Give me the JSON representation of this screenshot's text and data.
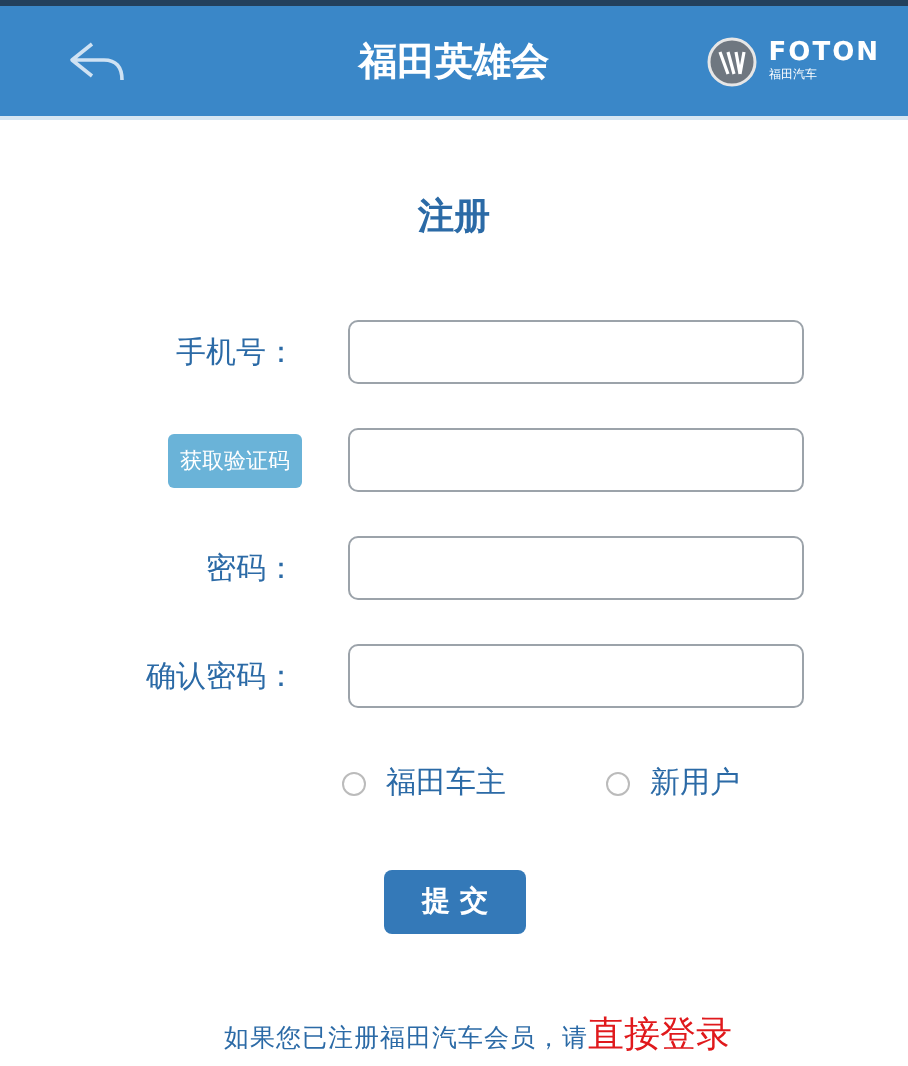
{
  "header": {
    "title": "福田英雄会",
    "logo": {
      "wordmark": "FOTON",
      "subtitle": "福田汽车"
    }
  },
  "form": {
    "title": "注册",
    "fields": [
      {
        "kind": "label",
        "label": "手机号："
      },
      {
        "kind": "button",
        "label": "获取验证码"
      },
      {
        "kind": "label",
        "label": "密码："
      },
      {
        "kind": "label",
        "label": "确认密码："
      }
    ],
    "options": [
      {
        "label": "福田车主",
        "selected": false
      },
      {
        "label": "新用户",
        "selected": false
      }
    ],
    "submit": "提 交"
  },
  "footer": {
    "text": "如果您已注册福田汽车会员，请",
    "link": "直接登录"
  }
}
